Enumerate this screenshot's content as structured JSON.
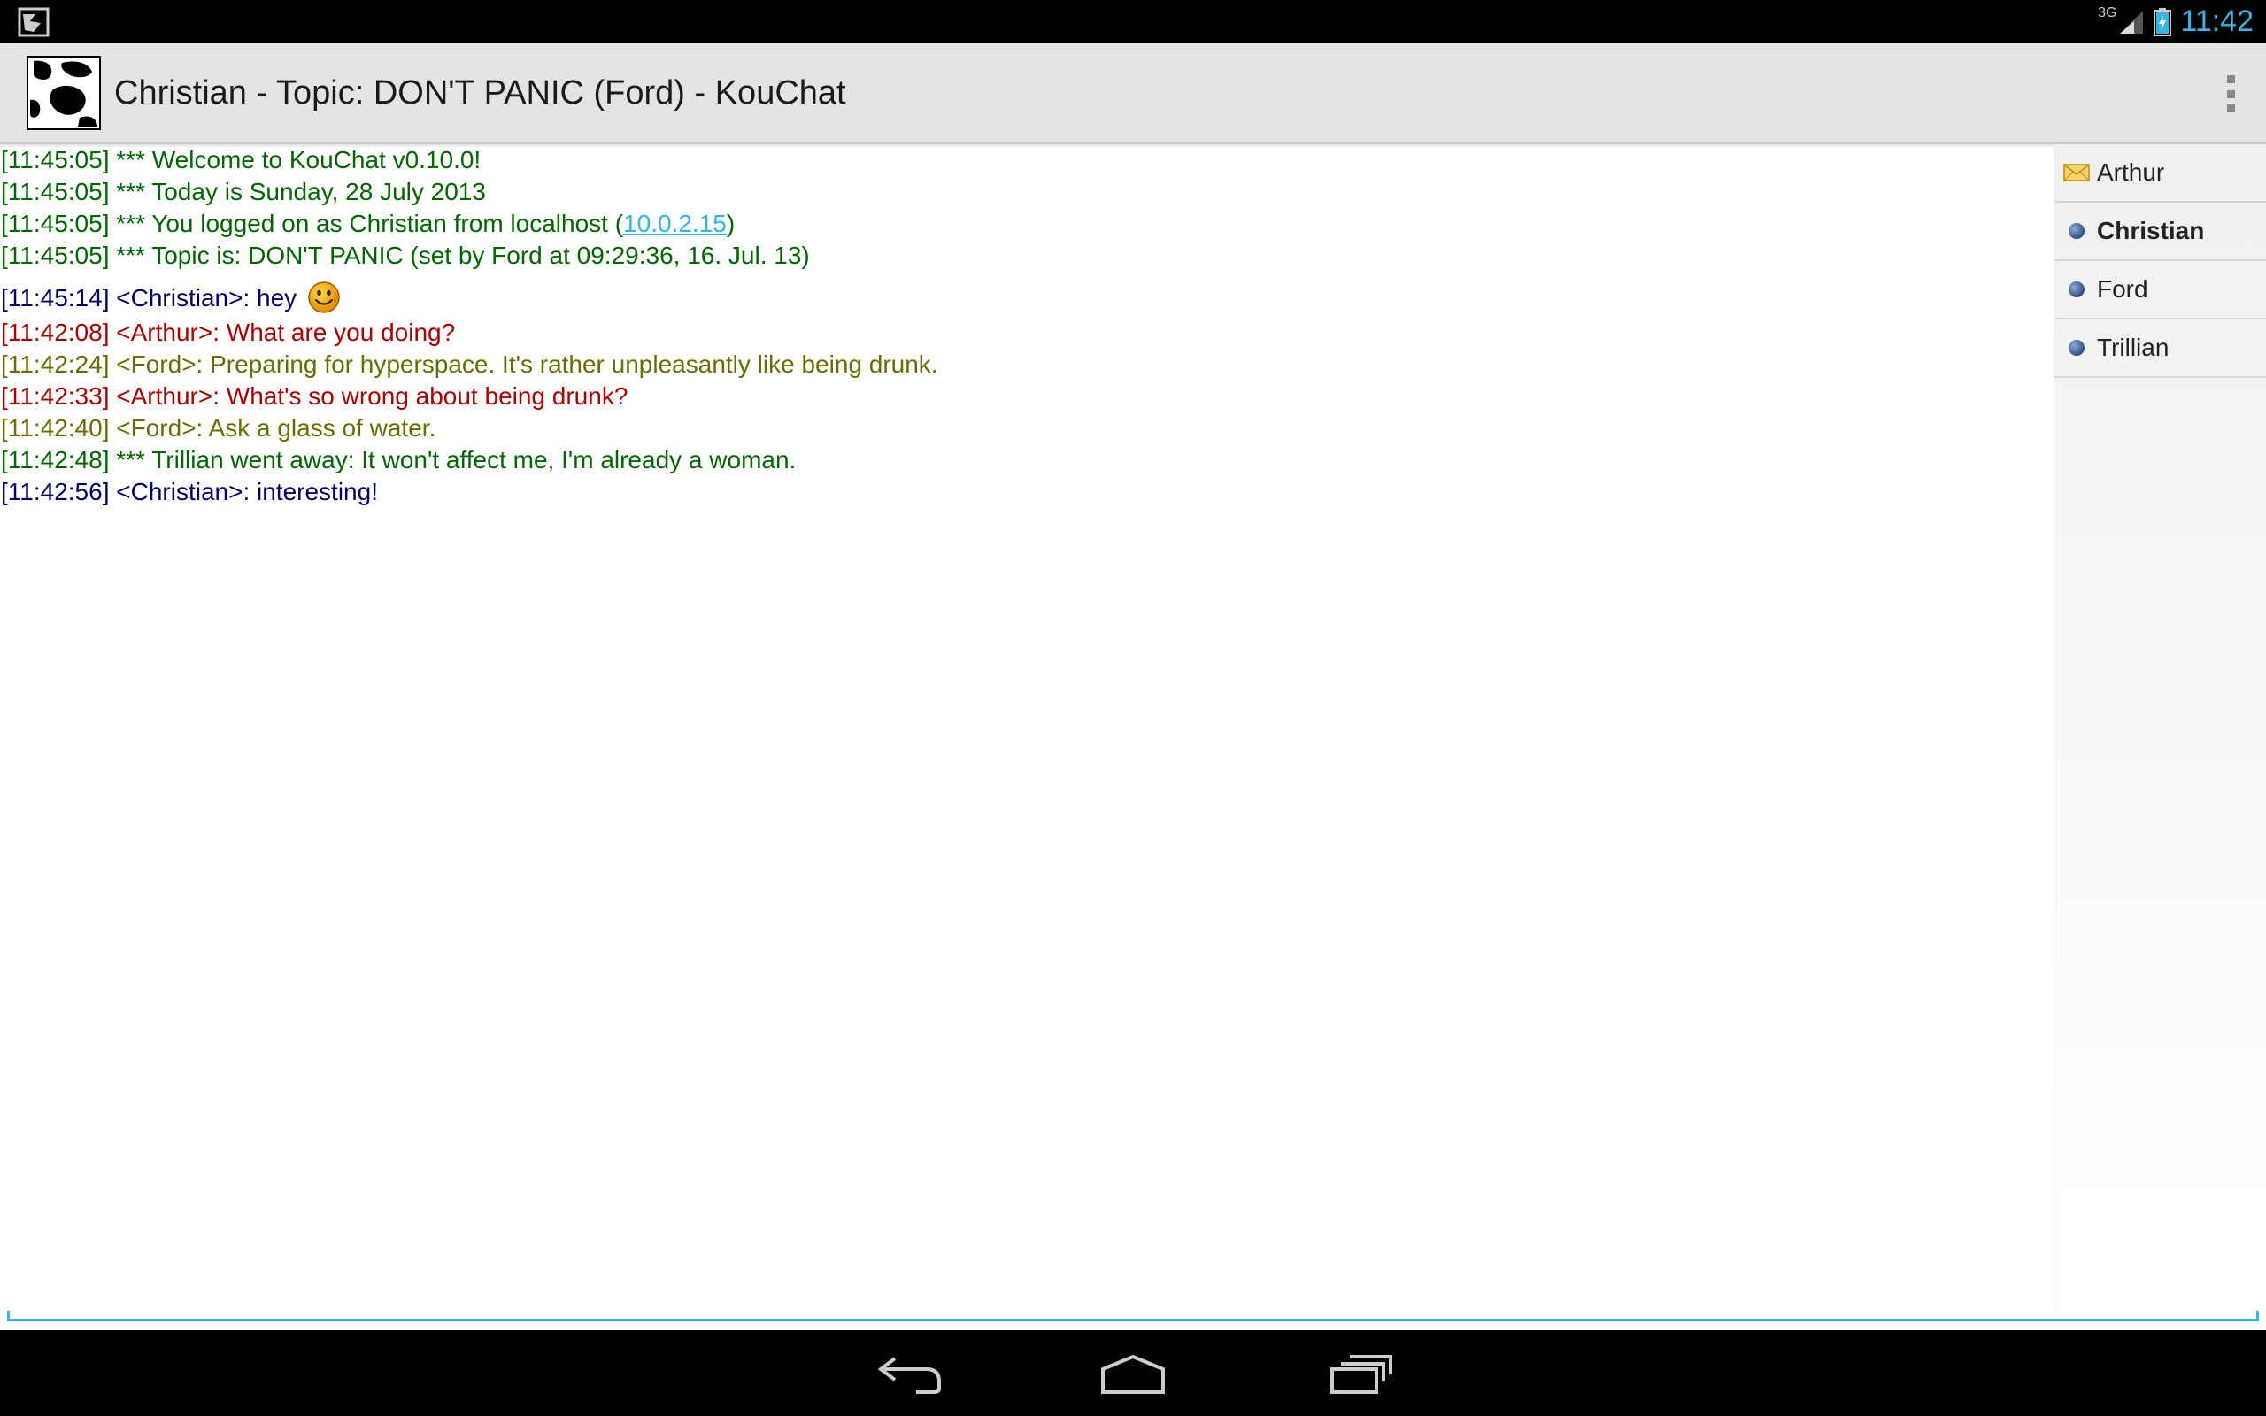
{
  "status_bar": {
    "network_label": "3G",
    "time": "11:42"
  },
  "action_bar": {
    "title": "Christian - Topic: DON'T PANIC (Ford) - KouChat"
  },
  "messages": [
    {
      "time": "[11:45:05]",
      "text": "*** Welcome to KouChat v0.10.0!"
    },
    {
      "time": "[11:45:05]",
      "text": "*** Today is Sunday, 28 July 2013"
    },
    {
      "time": "[11:45:05]",
      "text": "*** You logged on as Christian from localhost (",
      "link": "10.0.2.15",
      "after": ")"
    },
    {
      "time": "[11:45:05]",
      "text": "*** Topic is: DON'T PANIC (set by Ford at 09:29:36, 16. Jul. 13)"
    },
    {
      "time": "[11:45:14]",
      "text": "<Christian>: hey"
    },
    {
      "time": "[11:42:08]",
      "text": "<Arthur>: What are you doing?"
    },
    {
      "time": "[11:42:24]",
      "text": "<Ford>: Preparing for hyperspace. It's rather unpleasantly like being drunk."
    },
    {
      "time": "[11:42:33]",
      "text": "<Arthur>: What's so wrong about being drunk?"
    },
    {
      "time": "[11:42:40]",
      "text": "<Ford>: Ask a glass of water."
    },
    {
      "time": "[11:42:48]",
      "text": "*** Trillian went away: It won't affect me, I'm already a woman."
    },
    {
      "time": "[11:42:56]",
      "text": "<Christian>: interesting!"
    }
  ],
  "users": [
    {
      "name": "Arthur",
      "icon": "envelope-icon"
    },
    {
      "name": "Christian",
      "icon": "user-dot-icon"
    },
    {
      "name": "Ford",
      "icon": "user-dot-icon"
    },
    {
      "name": "Trillian",
      "icon": "user-dot-icon"
    }
  ],
  "input": {
    "value": "",
    "placeholder": ""
  },
  "colors": {
    "info": "#006600",
    "me": "#000066",
    "arthur": "#aa0000",
    "ford": "#6b6b00",
    "accent": "#33b5e5"
  }
}
